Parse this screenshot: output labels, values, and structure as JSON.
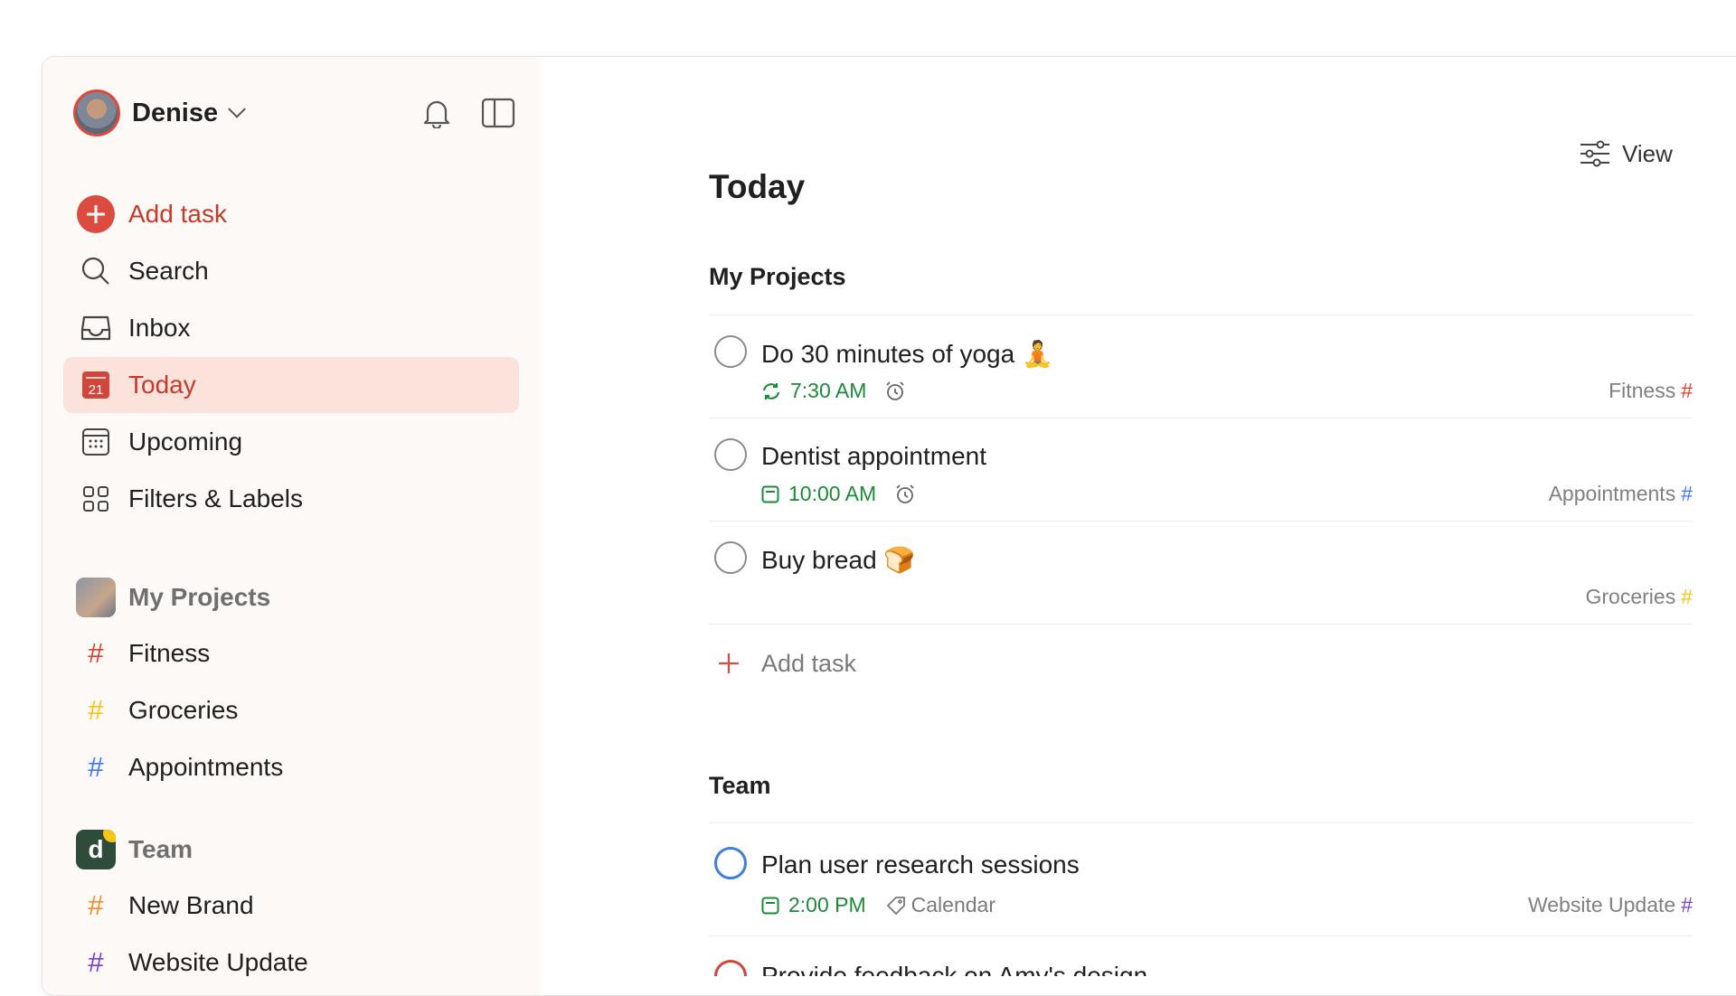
{
  "user": {
    "name": "Denise"
  },
  "nav": {
    "add_task": "Add task",
    "search": "Search",
    "inbox": "Inbox",
    "today": "Today",
    "today_date": "21",
    "upcoming": "Upcoming",
    "filters_labels": "Filters & Labels"
  },
  "sidebar_projects": {
    "my_projects": "My Projects",
    "items": [
      {
        "label": "Fitness",
        "color": "#db4035"
      },
      {
        "label": "Groceries",
        "color": "#f5c518"
      },
      {
        "label": "Appointments",
        "color": "#4073ff"
      }
    ],
    "team": "Team",
    "team_initial": "d",
    "team_items": [
      {
        "label": "New Brand",
        "color": "#f28c28"
      },
      {
        "label": "Website Update",
        "color": "#7a3fd1"
      }
    ]
  },
  "main": {
    "view_label": "View",
    "title": "Today",
    "groups": [
      {
        "title": "My Projects",
        "tasks": [
          {
            "title": "Do 30 minutes of yoga",
            "emoji": "🧘",
            "time": "7:30 AM",
            "project": "Fitness",
            "project_color": "#db4035"
          },
          {
            "title": "Dentist appointment",
            "time": "10:00 AM",
            "project": "Appointments",
            "project_color": "#4073ff"
          },
          {
            "title": "Buy bread",
            "emoji": "🍞",
            "time": "",
            "project": "Groceries",
            "project_color": "#f5c518"
          }
        ],
        "add_task": "Add task"
      },
      {
        "title": "Team",
        "tasks": [
          {
            "title": "Plan user research sessions",
            "time": "2:00 PM",
            "label": "Calendar",
            "project": "Website Update",
            "project_color": "#7a3fd1"
          },
          {
            "title": "Provide feedback on Amy's design"
          }
        ]
      }
    ]
  },
  "colors": {
    "accent": "#dc4c3e",
    "due": "#1d8a3a"
  }
}
